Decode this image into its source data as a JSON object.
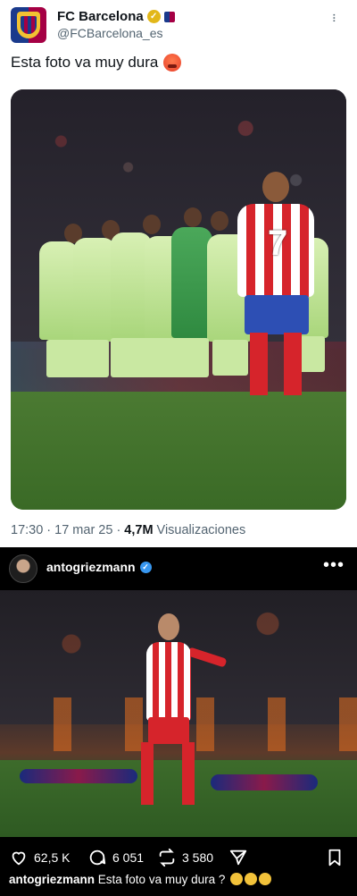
{
  "tweet": {
    "display_name": "FC Barcelona",
    "handle": "@FCBarcelona_es",
    "text": "Esta foto va muy dura",
    "text_emoji_icon": "hot-face-emoji",
    "time": "17:30",
    "date": "17 mar 25",
    "views_count": "4,7M",
    "views_label": "Visualizaciones",
    "separator": "·",
    "more_glyph": "···",
    "verified_icon": "gold-check-icon",
    "verified_mark": "✓",
    "photo_number": "7"
  },
  "instagram": {
    "username": "antogriezmann",
    "verified_mark": "✓",
    "more_glyph": "•••",
    "likes": "62,5 K",
    "comments": "6 051",
    "reposts": "3 580",
    "caption_user": "antogriezmann",
    "caption_text": "Esta foto va muy dura ?",
    "caption_emoji_icon": "shushing-face-emoji"
  },
  "colors": {
    "tweet_text": "#0f1419",
    "tweet_secondary": "#536471",
    "ig_background": "#000000",
    "atletico_red": "#d6242b",
    "barca_blue": "#1a3a8c",
    "barca_garnet": "#a50044"
  }
}
